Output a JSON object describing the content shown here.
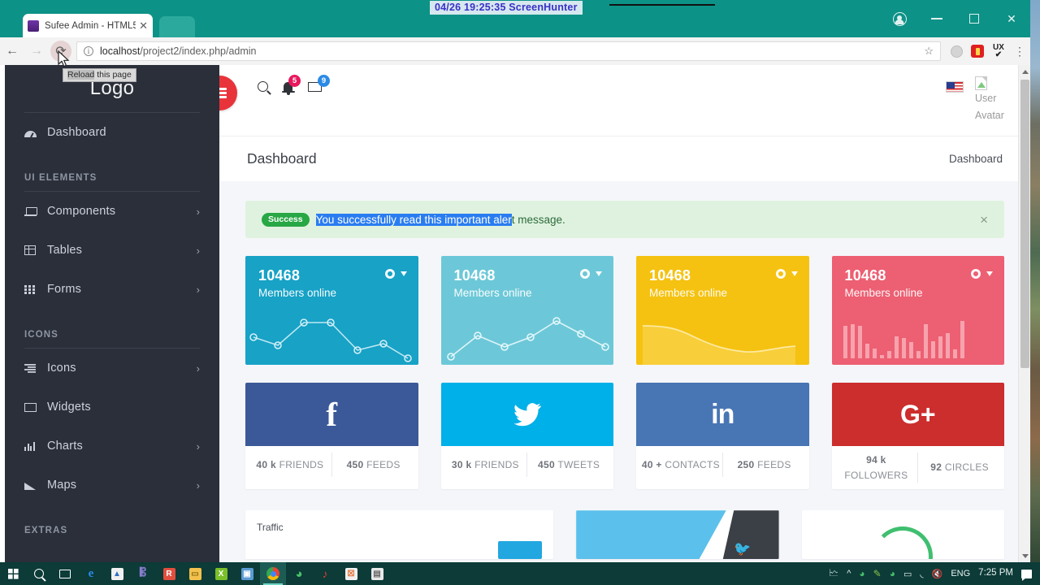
{
  "browser": {
    "tab_title": "Sufee Admin - HTML5 A",
    "tab_close": "✕",
    "url_host": "localhost",
    "url_path": "/project2/index.php/admin",
    "back_icon": "←",
    "forward_icon": "→",
    "reload_icon": "⟳",
    "star_icon": "☆",
    "kebab_icon": "⋮",
    "ext_ux_label": "UX",
    "ext_ux_check": "✔",
    "minimize": "—",
    "maximize": "▢",
    "close": "✕",
    "tooltip_selected": "Reload",
    "tooltip_rest": " this page"
  },
  "screenhunter": {
    "overlay_text": "04/26  19:25:35  ScreenHunter"
  },
  "sidebar": {
    "logo": "Logo",
    "items": [
      {
        "label": "Dashboard",
        "icon": "dashboard-icon",
        "caret": ""
      },
      {
        "label": "Components",
        "icon": "laptop-icon",
        "caret": "›"
      },
      {
        "label": "Tables",
        "icon": "table-icon",
        "caret": "›"
      },
      {
        "label": "Forms",
        "icon": "grid-icon",
        "caret": "›"
      },
      {
        "label": "Icons",
        "icon": "lines-icon",
        "caret": "›"
      },
      {
        "label": "Widgets",
        "icon": "mail-icon",
        "caret": ""
      },
      {
        "label": "Charts",
        "icon": "bar-chart-icon",
        "caret": "›"
      },
      {
        "label": "Maps",
        "icon": "area-chart-icon",
        "caret": "›"
      }
    ],
    "sections": {
      "ui_elements": "UI ELEMENTS",
      "icons": "ICONS",
      "extras": "EXTRAS"
    }
  },
  "header": {
    "menu_toggle": "hamburger-icon",
    "search_icon": "search-icon",
    "notification_badge": "5",
    "message_badge": "9",
    "flag": "us-flag-icon",
    "avatar_line1": "User",
    "avatar_line2": "Avatar"
  },
  "page": {
    "title": "Dashboard",
    "breadcrumb": "Dashboard"
  },
  "alert": {
    "badge": "Success",
    "selected_text": "You successfully read this important aler",
    "rest_text": "t message.",
    "close": "×"
  },
  "stat_cards": [
    {
      "value": "10468",
      "label": "Members online",
      "color": "#17a2c6",
      "chart": "line"
    },
    {
      "value": "10468",
      "label": "Members online",
      "color": "#6cc8d8",
      "chart": "line"
    },
    {
      "value": "10468",
      "label": "Members online",
      "color": "#f5c211",
      "chart": "area"
    },
    {
      "value": "10468",
      "label": "Members online",
      "color": "#ed5f72",
      "chart": "bar"
    }
  ],
  "social_cards": [
    {
      "network": "facebook",
      "glyph": "f",
      "color": "#3b5998",
      "stat1_value": "40 k",
      "stat1_label": "FRIENDS",
      "stat2_value": "450",
      "stat2_label": "FEEDS"
    },
    {
      "network": "twitter",
      "glyph": "🐦",
      "color": "#00b0e8",
      "stat1_value": "30 k",
      "stat1_label": "FRIENDS",
      "stat2_value": "450",
      "stat2_label": "TWEETS"
    },
    {
      "network": "linkedin",
      "glyph": "in",
      "color": "#4875b4",
      "stat1_value": "40 +",
      "stat1_label": "CONTACTS",
      "stat2_value": "250",
      "stat2_label": "FEEDS"
    },
    {
      "network": "googleplus",
      "glyph": "G+",
      "color": "#cc2d2d",
      "stat1_value": "94 k",
      "stat1_label": "FOLLOWERS",
      "stat2_value": "92",
      "stat2_label": "CIRCLES"
    }
  ],
  "bottom_row": {
    "traffic_title": "Traffic",
    "twitter_card": "twitter-banner-card",
    "progress_card": "green-gauge-card"
  },
  "chart_data": [
    {
      "type": "line",
      "title": "Members online",
      "values": [
        38,
        28,
        62,
        60,
        22,
        30,
        10
      ],
      "x": [
        0,
        1,
        2,
        3,
        4,
        5,
        6
      ],
      "ylim": [
        0,
        70
      ],
      "grid": false,
      "legend": "none",
      "color": "#bfe7f2"
    },
    {
      "type": "line",
      "title": "Members online",
      "values": [
        8,
        42,
        24,
        40,
        62,
        44,
        26
      ],
      "x": [
        0,
        1,
        2,
        3,
        4,
        5,
        6
      ],
      "ylim": [
        0,
        70
      ],
      "grid": false,
      "legend": "none",
      "color": "#d6f0f6"
    },
    {
      "type": "area",
      "title": "Members online",
      "values": [
        50,
        50,
        48,
        36,
        24,
        18,
        16,
        24,
        22
      ],
      "x": [
        0,
        1,
        2,
        3,
        4,
        5,
        6,
        7,
        8
      ],
      "ylim": [
        0,
        60
      ],
      "grid": false,
      "legend": "none",
      "color": "#fbe08a"
    },
    {
      "type": "bar",
      "title": "Members online",
      "categories": [
        "1",
        "2",
        "3",
        "4",
        "5",
        "6",
        "7",
        "8",
        "9",
        "10",
        "11",
        "12",
        "13",
        "14",
        "15",
        "16",
        "17"
      ],
      "values": [
        44,
        46,
        44,
        20,
        13,
        5,
        10,
        30,
        28,
        22,
        10,
        46,
        23,
        30,
        34,
        12,
        50
      ],
      "ylim": [
        0,
        55
      ],
      "grid": false,
      "legend": "none",
      "color": "#f79aa7"
    }
  ],
  "taskbar": {
    "start": "windows-logo",
    "language": "ENG",
    "time": "7:25 PM",
    "items": [
      "start-button",
      "search-button",
      "task-view-button",
      "edge-icon",
      "store-icon",
      "app-icon-1",
      "file-explorer-icon",
      "excel-icon",
      "remote-desktop-icon",
      "chrome-icon",
      "app-icon-2",
      "app-icon-3",
      "app-icon-4",
      "notes-icon"
    ]
  }
}
